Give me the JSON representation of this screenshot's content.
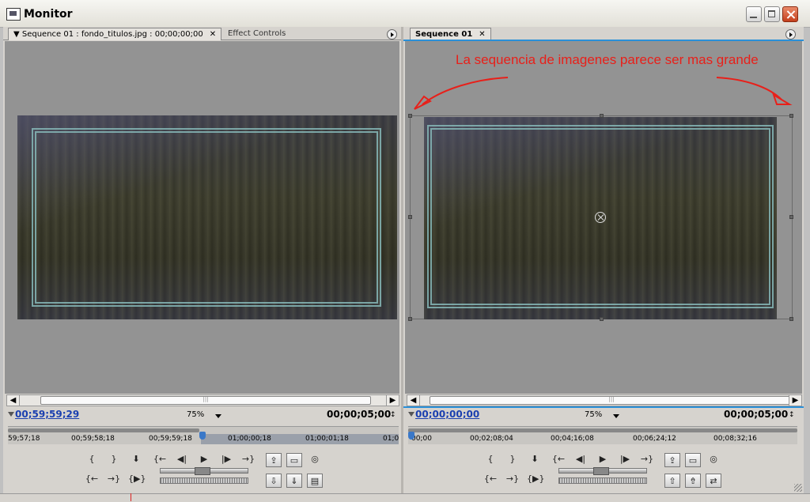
{
  "window": {
    "title": "Monitor",
    "icon": "monitor-app-icon"
  },
  "source_monitor": {
    "tabs": [
      {
        "label": "Sequence 01 : fondo_titulos.jpg : 00;00;00;00",
        "active": true,
        "dropdown": true
      },
      {
        "label": "Effect Controls",
        "active": false
      }
    ],
    "current_time": "00;59;59;29",
    "zoom": "75%",
    "duration": "00;00;05;00",
    "ruler_labels": [
      "59;57;18",
      "00;59;58;18",
      "00;59;59;18",
      "01;00;00;18",
      "01;00;01;18",
      "01;0"
    ]
  },
  "program_monitor": {
    "tabs": [
      {
        "label": "Sequence 01",
        "active": true
      }
    ],
    "annotation": "La sequencia de imagenes parece ser mas grande",
    "current_time": "00;00;00;00",
    "zoom": "75%",
    "duration": "00;00;05;00",
    "ruler_labels": [
      "00;00",
      "00;02;08;04",
      "00;04;16;08",
      "00;06;24;12",
      "00;08;32;16"
    ]
  },
  "controls": {
    "row1": [
      "{",
      "}",
      "⬇",
      "{←",
      "◀|",
      "▶",
      "|▶",
      "→}"
    ],
    "row2": [
      "{←",
      "→}",
      "{▶}"
    ]
  },
  "colors": {
    "accent": "#2a90d8",
    "timecode": "#1a3fb0",
    "annotation": "#e8201a",
    "viewer_bg": "#939393"
  }
}
